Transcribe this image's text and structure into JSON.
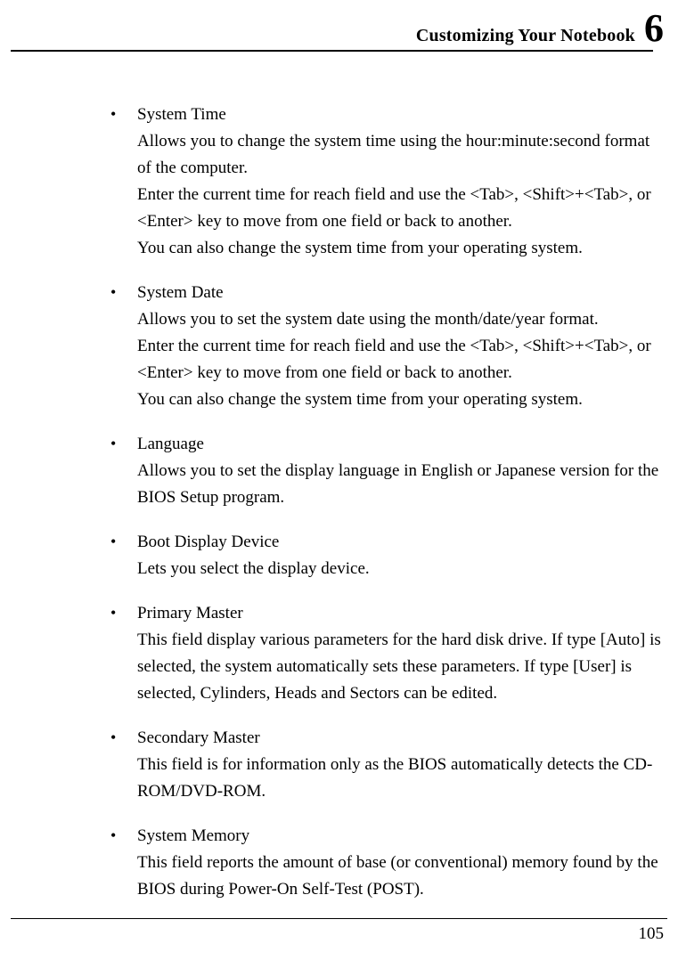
{
  "header": {
    "title": "Customizing Your Notebook",
    "chapter": "6"
  },
  "items": [
    {
      "title": "System Time",
      "desc": "Allows you to change the system time using the hour:minute:second format of the computer.\nEnter the current time for reach field and use the <Tab>, <Shift>+<Tab>, or <Enter> key to move from one field or back to another.\nYou can also change the system time from your operating system."
    },
    {
      "title": "System Date",
      "desc": "Allows you to set the system date using the month/date/year format.\nEnter the current time for reach field and use the <Tab>, <Shift>+<Tab>, or <Enter> key to move from one field or back to another.\nYou can also change the system time from your operating system."
    },
    {
      "title": "Language",
      "desc": "Allows you to set the display language in English or Japanese version for the BIOS Setup program."
    },
    {
      "title": "Boot Display Device",
      "desc": "Lets you select the display device."
    },
    {
      "title": "Primary Master",
      "desc": "This field display various parameters for the hard disk drive. If type [Auto] is selected, the system automatically sets these parameters. If type [User] is selected, Cylinders, Heads and Sectors can be edited."
    },
    {
      "title": "Secondary Master",
      "desc": "This field is for information only as the BIOS automatically detects the CD-ROM/DVD-ROM."
    },
    {
      "title": "System Memory",
      "desc": "This field reports the amount of base (or conventional) memory found by the BIOS during Power-On Self-Test (POST)."
    }
  ],
  "footer": {
    "page": "105"
  }
}
